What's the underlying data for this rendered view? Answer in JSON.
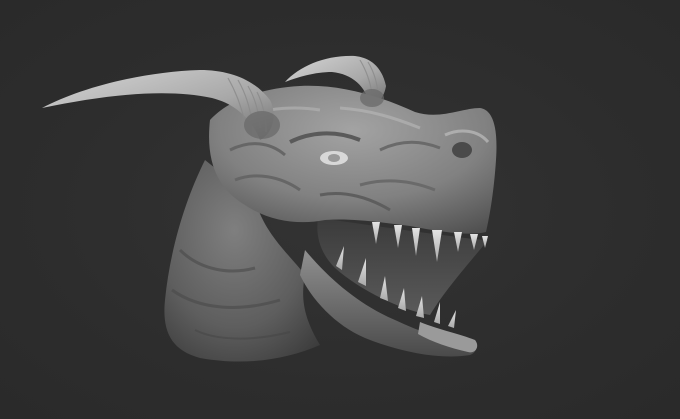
{
  "viewport": {
    "background_color": "#2d2d2d"
  },
  "subject": {
    "material_color": "#8a8a8a",
    "highlight_color": "#c9c9c9",
    "shadow_color": "#3e3e3e"
  }
}
